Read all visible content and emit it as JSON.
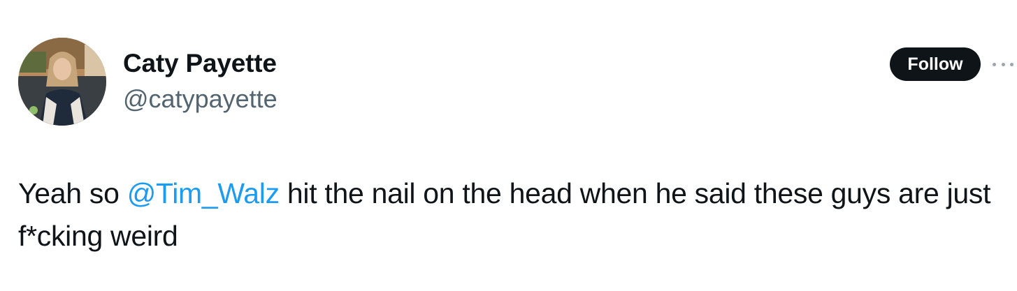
{
  "author": {
    "display_name": "Caty Payette",
    "handle": "@catypayette"
  },
  "actions": {
    "follow_label": "Follow",
    "more_icon": "ellipsis-icon"
  },
  "tweet": {
    "text_before": "Yeah so ",
    "mention": "@Tim_Walz",
    "text_after": " hit the nail on the head when he said these guys are just f*cking weird"
  },
  "colors": {
    "text": "#0f1419",
    "secondary": "#536471",
    "link": "#1d9bf0",
    "button_bg": "#0f1419"
  }
}
